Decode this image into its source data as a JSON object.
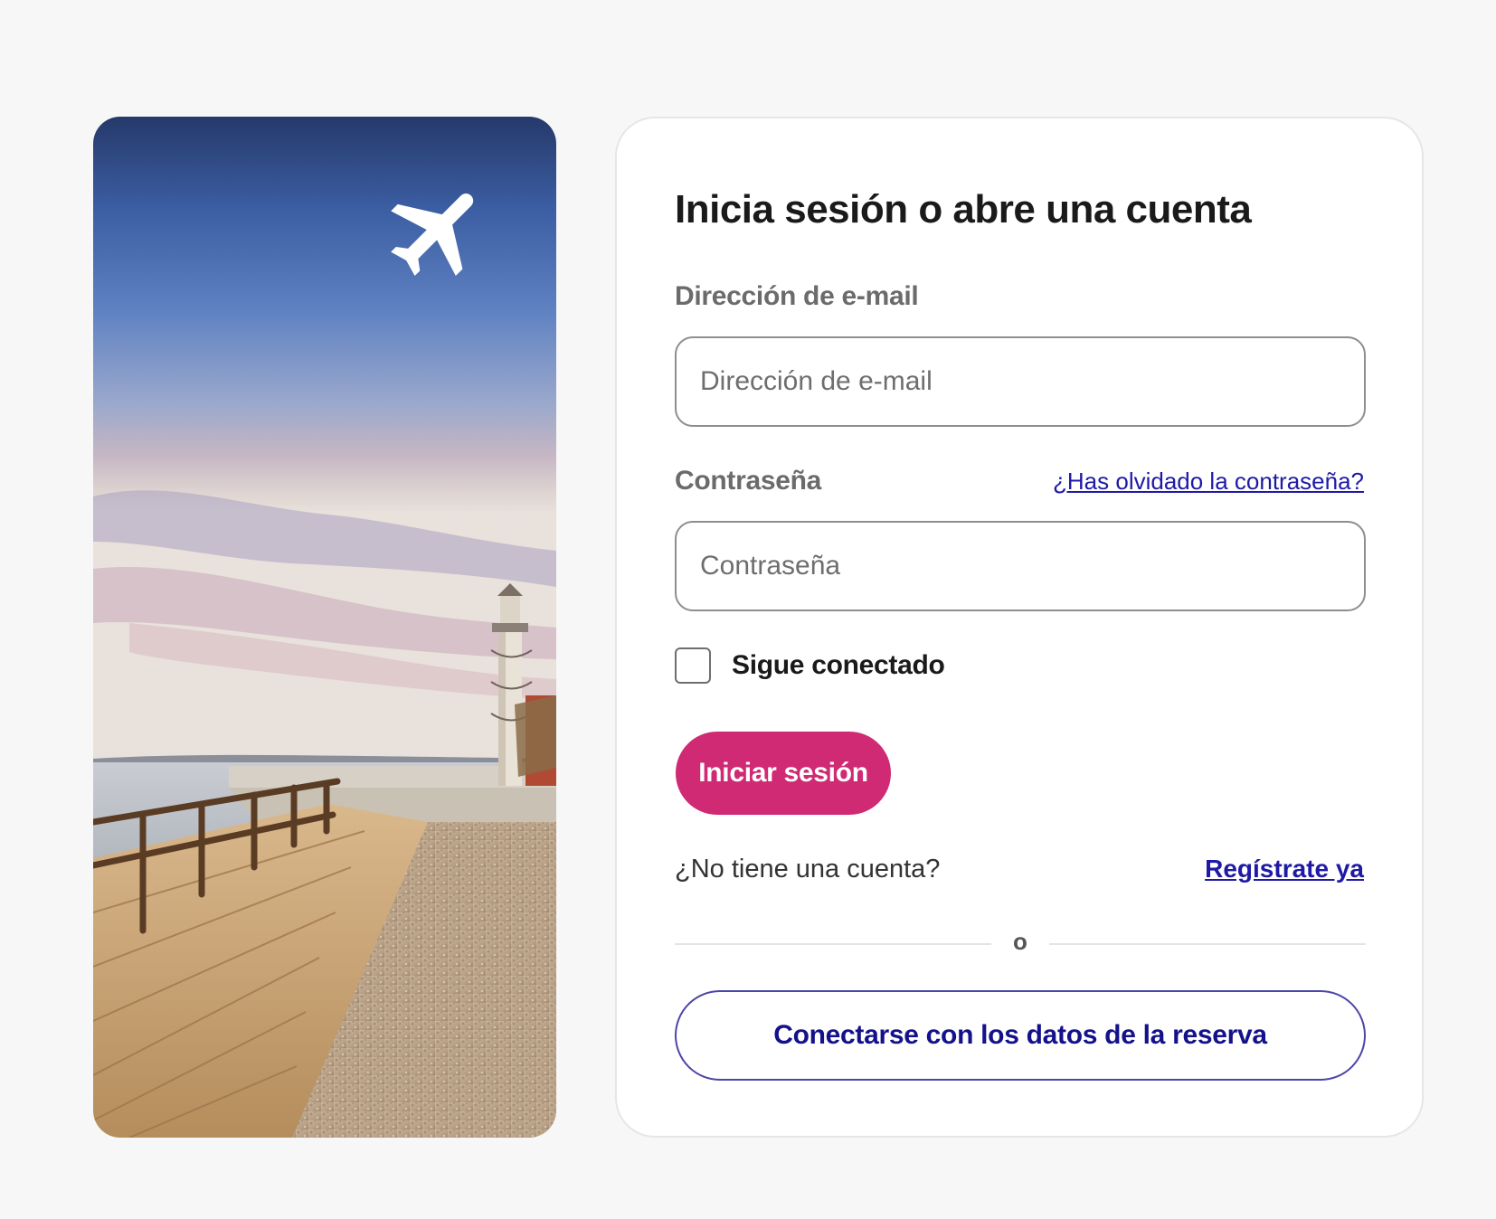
{
  "login_card": {
    "title": "Inicia sesión o abre una cuenta",
    "email_label": "Dirección de e-mail",
    "email_placeholder": "Dirección de e-mail",
    "email_value": "",
    "password_label": "Contraseña",
    "password_placeholder": "Contraseña",
    "password_value": "",
    "forgot_password_link": "¿Has olvidado la contraseña?",
    "stay_connected_label": "Sigue conectado",
    "stay_connected_checked": false,
    "login_button": "Iniciar sesión",
    "no_account_text": "¿No tiene una cuenta?",
    "register_link": "Regístrate ya",
    "divider_text": "o",
    "booking_button": "Conectarse con los datos de la reserva"
  },
  "photo_panel": {
    "icon": "airplane-icon"
  },
  "colors": {
    "page_background": "#f7f7f7",
    "primary_button": "#cf2a73",
    "link": "#1f1aa6",
    "outline_button_border": "#4c45a8",
    "outline_button_text": "#14118a"
  }
}
